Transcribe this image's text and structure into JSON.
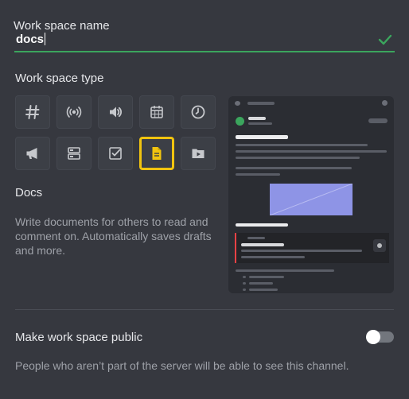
{
  "workspace_name": {
    "label": "Work space name",
    "value": "docs",
    "valid": true,
    "check_icon": "check-icon"
  },
  "workspace_type": {
    "label": "Work space type",
    "types": [
      {
        "name": "text",
        "icon": "hash-icon",
        "selected": false
      },
      {
        "name": "broadcast",
        "icon": "broadcast-icon",
        "selected": false
      },
      {
        "name": "voice",
        "icon": "speaker-icon",
        "selected": false
      },
      {
        "name": "calendar",
        "icon": "calendar-icon",
        "selected": false
      },
      {
        "name": "clock",
        "icon": "clock-icon",
        "selected": false
      },
      {
        "name": "announcement",
        "icon": "megaphone-icon",
        "selected": false
      },
      {
        "name": "board",
        "icon": "board-icon",
        "selected": false
      },
      {
        "name": "tasks",
        "icon": "checkbox-icon",
        "selected": false
      },
      {
        "name": "docs",
        "icon": "document-icon",
        "selected": true
      },
      {
        "name": "video",
        "icon": "video-icon",
        "selected": false
      }
    ],
    "selected_title": "Docs",
    "selected_description": "Write documents for others to read and comment on. Automatically saves drafts and more."
  },
  "public": {
    "label": "Make work space public",
    "enabled": false,
    "description": "People who aren’t part of the server will be able to see this channel."
  },
  "colors": {
    "background": "#36383f",
    "accent_selected": "#f1c40f",
    "valid_green": "#3ba55d",
    "preview_image": "#8e94e6"
  }
}
